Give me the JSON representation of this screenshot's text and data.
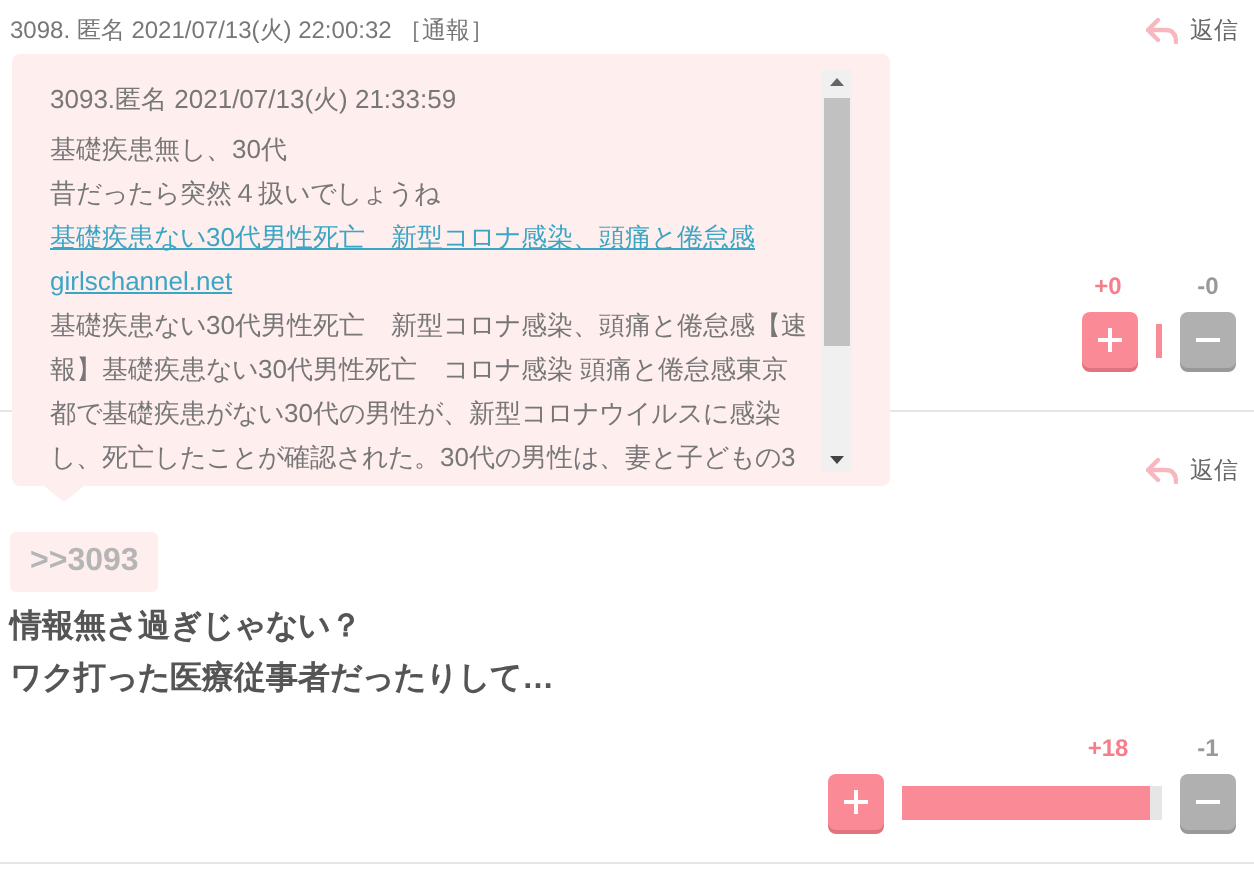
{
  "comments": [
    {
      "header": "3098. 匿名 2021/07/13(火) 22:00:32 ［通報］",
      "reply": "返信",
      "votes": {
        "plus": "+0",
        "minus": "-0",
        "kind": "compact",
        "level": 1
      },
      "popup": {
        "header": "3093.匿名 2021/07/13(火) 21:33:59",
        "lines": [
          {
            "kind": "text",
            "text": "基礎疾患無し、30代"
          },
          {
            "kind": "text",
            "text": "昔だったら突然４扱いでしょうね"
          },
          {
            "kind": "link",
            "text": "基礎疾患ない30代男性死亡　新型コロナ感染、頭痛と倦怠感"
          },
          {
            "kind": "link",
            "text": "girlschannel.net"
          },
          {
            "kind": "text",
            "text": "基礎疾患ない30代男性死亡　新型コロナ感染、頭痛と倦怠感【速報】基礎疾患ない30代男性死亡　コロナ感染 頭痛と倦怠感東京都で基礎疾患がない30代の男性が、新型コロナウイルスに感染し、死亡したことが確認された。30代の男性は、妻と子どもの3"
          }
        ]
      }
    },
    {
      "reply": "返信",
      "quote": ">>3093",
      "body": [
        "情報無さ過ぎじゃない？",
        "ワク打った医療従事者だったりして…"
      ],
      "votes": {
        "plus": "+18",
        "minus": "-1",
        "kind": "bar",
        "level": 0.95
      }
    }
  ]
}
